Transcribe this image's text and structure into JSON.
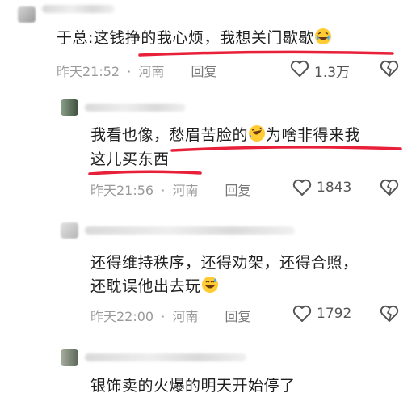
{
  "comments": [
    {
      "text": "于总:这钱挣的我心烦，我想关门歇歇",
      "time": "昨天21:52",
      "location": "河南",
      "reply_label": "回复",
      "likes": "1.3万"
    },
    {
      "text_part1": "我看也像，愁眉苦脸的",
      "text_part2": "为啥非得来我",
      "text_line2": "这儿买东西",
      "time": "昨天21:56",
      "location": "河南",
      "reply_label": "回复",
      "likes": "1843"
    },
    {
      "text_line1": "还得维持秩序，还得劝架，还得合照，",
      "text_line2": "还耽误他出去玩",
      "time": "昨天22:00",
      "location": "河南",
      "reply_label": "回复",
      "likes": "1792"
    },
    {
      "text": "银饰卖的火爆的明天开始停了"
    }
  ],
  "colors": {
    "annotation": "#e8203a",
    "meta": "#9a9a9a"
  },
  "icons": [
    "heart-outline-icon",
    "dislike-heart-icon",
    "laughing-tears-emoji",
    "rolling-laugh-emoji",
    "sweat-smile-emoji"
  ]
}
